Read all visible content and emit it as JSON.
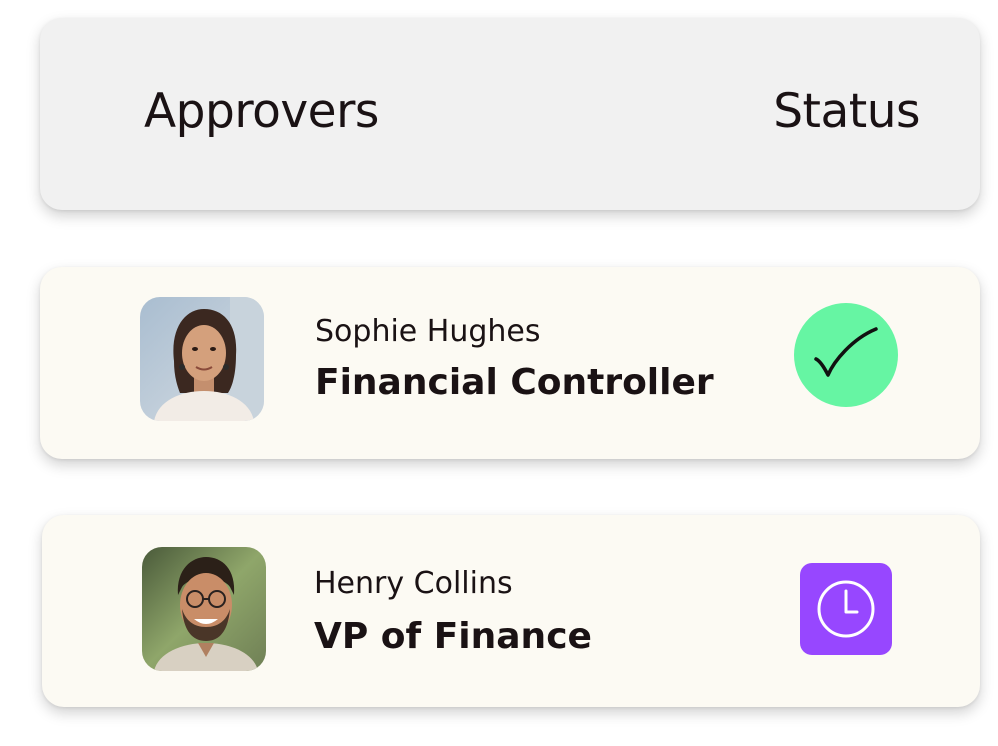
{
  "header": {
    "approvers_label": "Approvers",
    "status_label": "Status"
  },
  "approvers": [
    {
      "name": "Sophie Hughes",
      "role": "Financial Controller",
      "status": "approved",
      "status_icon": "check-icon",
      "status_color": "#66f5a3"
    },
    {
      "name": "Henry Collins",
      "role": "VP of Finance",
      "status": "pending",
      "status_icon": "clock-icon",
      "status_color": "#9747ff"
    }
  ]
}
